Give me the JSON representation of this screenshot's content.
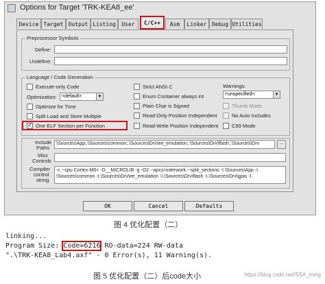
{
  "dialog": {
    "title": "Options for Target 'TRK-KEA8_ee'",
    "tabs": [
      {
        "label": "Device"
      },
      {
        "label": "Target"
      },
      {
        "label": "Output"
      },
      {
        "label": "Listing"
      },
      {
        "label": "User"
      },
      {
        "label": "C/C++"
      },
      {
        "label": "Asm"
      },
      {
        "label": "Linker"
      },
      {
        "label": "Debug"
      },
      {
        "label": "Utilities"
      }
    ],
    "active_tab": "C/C++",
    "preprocessor": {
      "title": "Preprocessor Symbols",
      "define_label": "Define:",
      "define_value": "",
      "undefine_label": "Undefine:",
      "undefine_value": ""
    },
    "language": {
      "title": "Language / Code Generation",
      "execute_only": "Execute-only Code",
      "optimization_label": "Optimization:",
      "optimization_value": "<default>",
      "optimize_time": "Optimize for Time",
      "split_load": "Split Load and Store Multiple",
      "one_elf": "One ELF Section per Function",
      "strict_ansi": "Strict ANSI C",
      "enum_container": "Enum Container always int",
      "plain_char": "Plain Char is Signed",
      "ro_pi": "Read-Only Position Independent",
      "rw_pi": "Read-Write Position Independent",
      "warnings_label": "Warnings:",
      "warnings_value": "<unspecified>",
      "thumb_mode": "Thumb Mode",
      "no_auto_includes": "No Auto Includes",
      "c99_mode": "C99 Mode"
    },
    "include_paths_label_1": "Include",
    "include_paths_label_2": "Paths",
    "include_paths_value": "\\Sources\\App;.\\Sources\\common;.\\Sources\\Drv\\ee_emulation;.\\Sources\\Drv\\flash;.\\Sources\\Drv",
    "browse_label": "...",
    "misc_label_1": "Misc",
    "misc_label_2": "Controls",
    "misc_value": "",
    "compiler_label_1": "Compiler",
    "compiler_label_2": "control",
    "compiler_label_3": "string",
    "compiler_line_1": "-c --cpu Cortex-M0+ -D__MICROLIB -g -O2 --apcs=interwork --split_sections -I.\\Sources\\App -I.",
    "compiler_line_2": "\\Sources\\common -I.\\Sources\\Drv\\ee_emulation -I.\\Sources\\Drv\\flash -I.\\Sources\\Drv\\gpio -I.",
    "buttons": {
      "ok": "OK",
      "cancel": "Cancel",
      "defaults": "Defaults"
    }
  },
  "caption_1": "图 4  优化配置（二）",
  "console": {
    "line_1": "linking...",
    "line_2_prefix": "Program Size: ",
    "line_2_code": "Code=6216",
    "line_2_rest": " RO-data=224 RW-data",
    "line_3": "\".\\TRK-KEA8_Lab4.axf\" - 0 Error(s), 11 Warning(s)."
  },
  "caption_2": "图 5  优化配置（二）后code大小",
  "watermark": "https://blog.csdn.net/SSA_ming",
  "colors": {
    "highlight": "#c8161d",
    "dialog_bg": "#e2e2e2"
  }
}
